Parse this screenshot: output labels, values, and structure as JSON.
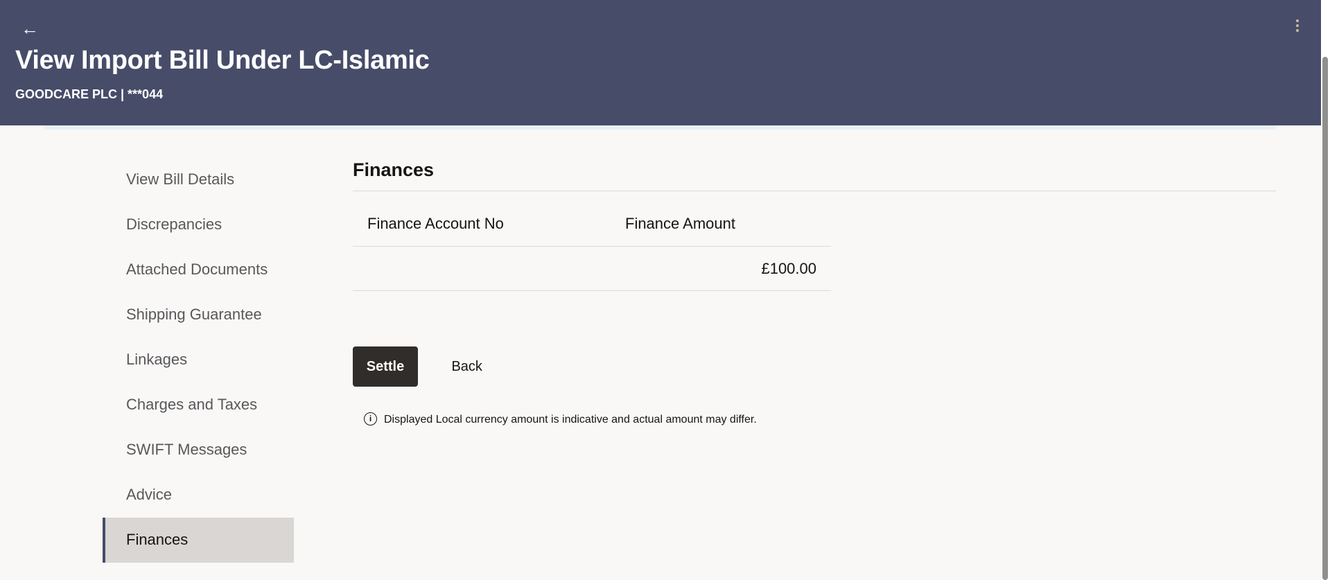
{
  "header": {
    "back_icon": "left-arrow-icon",
    "title": "View Import Bill Under LC-Islamic",
    "subtitle": "GOODCARE PLC | ***044",
    "menu_icon": "kebab-menu-icon",
    "background_color": "#474c69"
  },
  "sidebar": {
    "items": [
      {
        "label": "View Bill Details",
        "active": false
      },
      {
        "label": "Discrepancies",
        "active": false
      },
      {
        "label": "Attached Documents",
        "active": false
      },
      {
        "label": "Shipping Guarantee",
        "active": false
      },
      {
        "label": "Linkages",
        "active": false
      },
      {
        "label": "Charges and Taxes",
        "active": false
      },
      {
        "label": "SWIFT Messages",
        "active": false
      },
      {
        "label": "Advice",
        "active": false
      },
      {
        "label": "Finances",
        "active": true
      }
    ]
  },
  "main": {
    "section_title": "Finances",
    "table": {
      "columns": [
        "Finance Account No",
        "Finance Amount"
      ],
      "rows": [
        {
          "account_no": "",
          "amount": "£100.00"
        }
      ]
    },
    "settle_label": "Settle",
    "back_label": "Back",
    "note_icon": "info-icon",
    "note": "Displayed Local currency amount is indicative and actual amount may differ."
  },
  "colors": {
    "primary_button": "#312d2a",
    "active_nav_accent": "#474c69",
    "page_background": "#f9f8f7"
  }
}
